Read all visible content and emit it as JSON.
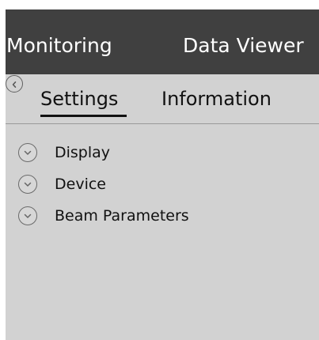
{
  "top_tabs": [
    {
      "label": "Monitoring"
    },
    {
      "label": "Data Viewer"
    }
  ],
  "sub_tabs": [
    {
      "label": "Settings",
      "active": true
    },
    {
      "label": "Information",
      "active": false
    }
  ],
  "sections": [
    {
      "label": "Display",
      "icon": "chevron-down-circle-icon"
    },
    {
      "label": "Device",
      "icon": "chevron-down-circle-icon"
    },
    {
      "label": "Beam Parameters",
      "icon": "chevron-down-circle-icon"
    }
  ],
  "icons": {
    "back": "chevron-left-circle-icon",
    "expand": "chevron-down-circle-icon"
  },
  "colors": {
    "top_bar": "#404040",
    "panel": "#d2d2d2",
    "text": "#111111",
    "active_underline": "#111111"
  }
}
